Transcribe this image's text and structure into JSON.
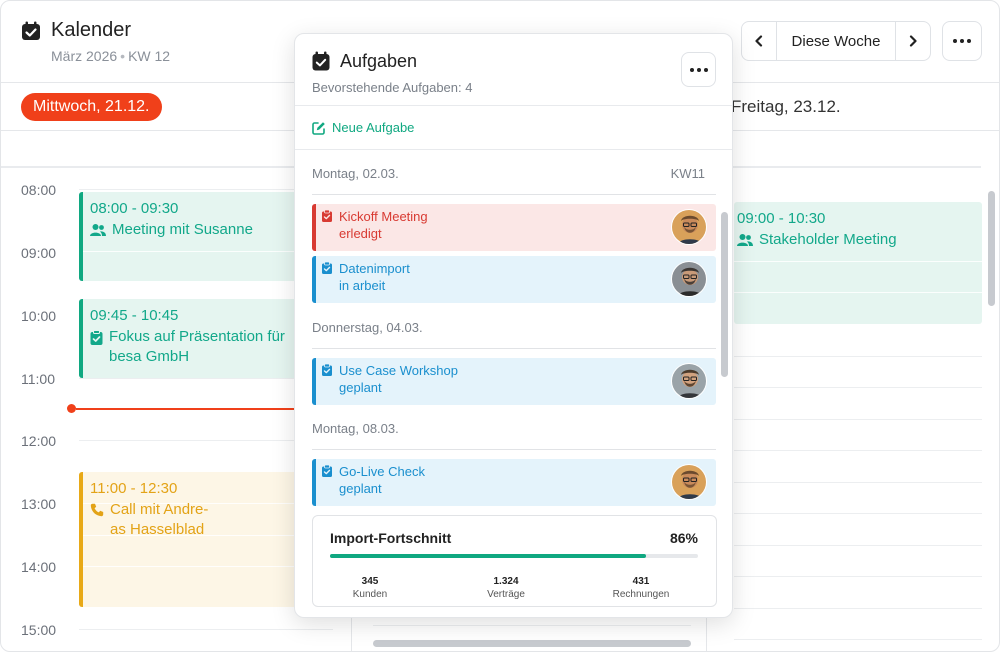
{
  "colors": {
    "accent_green": "#10a881",
    "today_red": "#f0401a",
    "status_red": "#d83a32",
    "status_blue": "#1a8fce",
    "event_yellow": "#e8a917"
  },
  "calendar": {
    "title": "Kalender",
    "month": "März 2026",
    "week": "KW 12",
    "week_nav": {
      "prev_icon": "chevron-left-icon",
      "label": "Diese Woche",
      "next_icon": "chevron-right-icon"
    },
    "more_icon": "more-horizontal-icon",
    "days": {
      "wednesday": "Mittwoch, 21.12.",
      "friday": "Freitag, 23.12."
    },
    "times": [
      "08:00",
      "09:00",
      "10:00",
      "11:00",
      "12:00",
      "13:00",
      "14:00",
      "15:00"
    ],
    "events": [
      {
        "time": "08:00 - 09:30",
        "title": "Meeting mit Susanne",
        "icon": "users-icon"
      },
      {
        "time": "09:45 - 10:45",
        "title": "Fokus auf Präsentation für",
        "title_line2": "besa GmbH",
        "icon": "clipboard-check-icon"
      },
      {
        "time": "11:00 - 12:30",
        "title": "Call mit Andre-",
        "title_line2": "as Hasselblad",
        "icon": "phone-icon"
      },
      {
        "time": "09:00 - 10:30",
        "title": "Stakeholder Meeting",
        "icon": "users-icon"
      }
    ]
  },
  "tasks_panel": {
    "title": "Aufgaben",
    "subtitle": "Bevorstehende Aufgaben: 4",
    "new_task": "Neue Aufgabe",
    "sections": [
      {
        "date": "Montag, 02.03.",
        "week": "KW11",
        "tasks": [
          {
            "name": "Kickoff Meeting",
            "status": "erledigt",
            "variant": "red"
          },
          {
            "name": "Datenimport",
            "status": "in arbeit",
            "variant": "blue"
          }
        ]
      },
      {
        "date": "Donnerstag, 04.03.",
        "tasks": [
          {
            "name": "Use Case Workshop",
            "status": "geplant",
            "variant": "blue"
          }
        ]
      },
      {
        "date": "Montag, 08.03.",
        "tasks": [
          {
            "name": "Go-Live Check",
            "status": "geplant",
            "variant": "blue"
          }
        ]
      }
    ],
    "progress": {
      "title": "Import-Fortschnitt",
      "percent_label": "86%",
      "value": 0.86,
      "stats": [
        {
          "value": "345",
          "label": "Kunden"
        },
        {
          "value": "1.324",
          "label": "Verträge"
        },
        {
          "value": "431",
          "label": "Rechnungen"
        }
      ]
    }
  }
}
